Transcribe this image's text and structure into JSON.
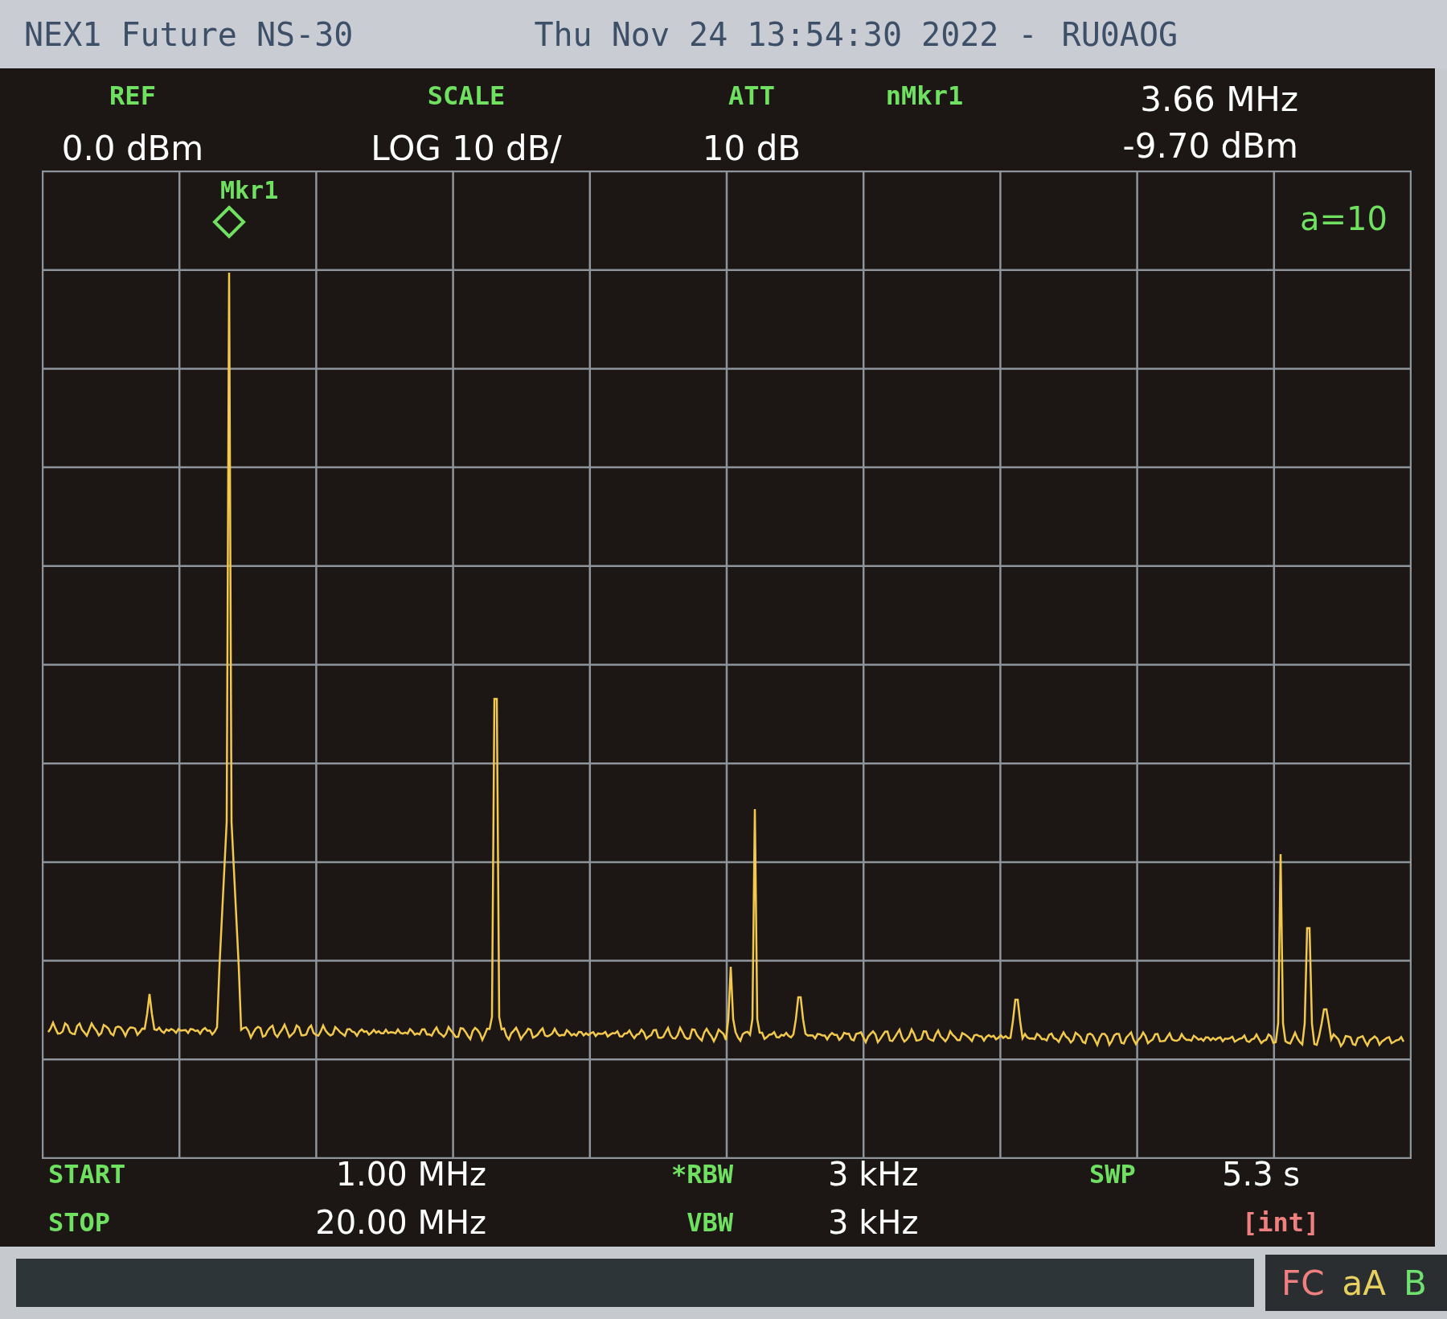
{
  "title_bar": {
    "device": "NEX1 Future NS-30",
    "datetime": "Thu Nov 24 13:54:30 2022 -",
    "callsign": "RU0AOG"
  },
  "header": [
    {
      "label": "REF",
      "value": "0.0 dBm"
    },
    {
      "label": "SCALE",
      "value": "LOG 10 dB/"
    },
    {
      "label": "ATT",
      "value": "10 dB"
    }
  ],
  "marker_readout": {
    "label": "nMkr1",
    "frequency": "3.66 MHz",
    "amplitude": "-9.70 dBm"
  },
  "plot": {
    "marker_label": "Mkr1",
    "averaging": "a=10"
  },
  "footer": [
    [
      {
        "kind": "pair",
        "label": "START",
        "value": "1.00 MHz"
      },
      {
        "kind": "pair",
        "label": "*RBW",
        "value": "3 kHz"
      },
      {
        "kind": "pair",
        "label": "SWP",
        "value": "5.3 s"
      }
    ],
    [
      {
        "kind": "pair",
        "label": "STOP",
        "value": "20.00 MHz"
      },
      {
        "kind": "pair",
        "label": "VBW",
        "value": "3 kHz"
      },
      {
        "kind": "flag",
        "text": "[int]"
      }
    ]
  ],
  "status_bar": [
    {
      "text": "FC",
      "color": "#f08080"
    },
    {
      "text": "aA",
      "color": "#e8d060"
    },
    {
      "text": "B",
      "color": "#70e070"
    }
  ]
}
